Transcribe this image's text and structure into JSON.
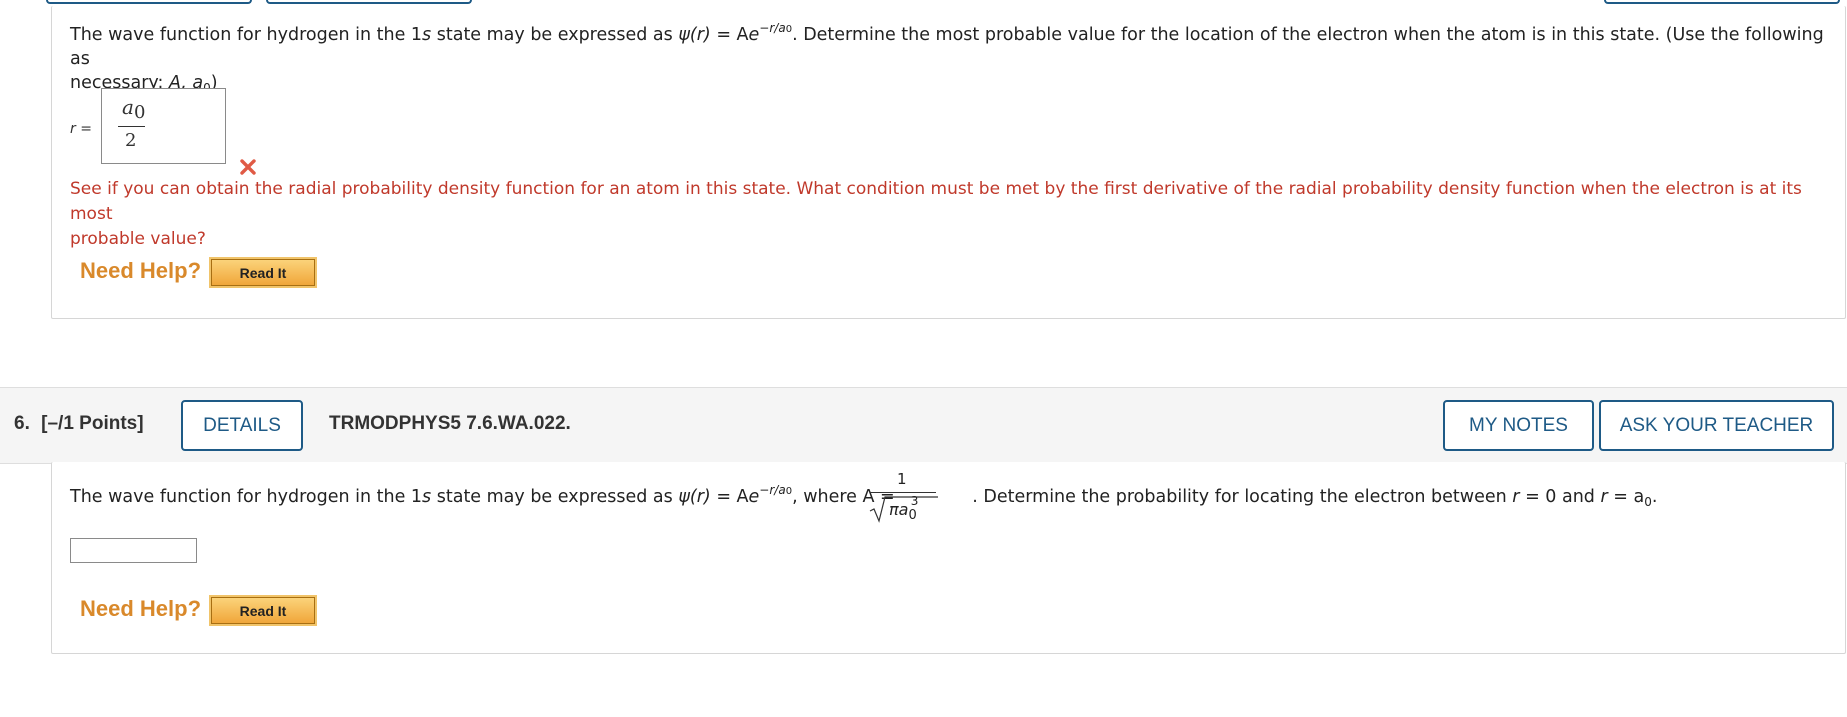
{
  "q5": {
    "text1": "The wave function for hydrogen in the 1",
    "s": "s",
    "text2": " state may be expressed as ",
    "psi": "ψ",
    "r_paren": "(r)",
    "eq": " = A",
    "e": "e",
    "exp": "−r/a",
    "exp_sub": "0",
    "text3": ". Determine the most probable value for the location of the electron when the atom is in this state. (Use the following as",
    "text4": "necessary: ",
    "vars": "A, a",
    "vars_sub": "0",
    "vars_close": ")",
    "answer_label": "r =",
    "answer_num": "a",
    "answer_num_sub": "0",
    "answer_den": "2",
    "hint_line1": "See if you can obtain the radial probability density function for an atom in this state. What condition must be met by the first derivative of the radial probability density function when the electron is at its most",
    "hint_line2": "probable value?",
    "need_help": "Need Help?",
    "read_it": "Read It",
    "status_color": "#e05a45"
  },
  "q6": {
    "number": "6.",
    "points": "[–/1 Points]",
    "details": "DETAILS",
    "code": "TRMODPHYS5 7.6.WA.022.",
    "my_notes": "MY NOTES",
    "ask_teacher": "ASK YOUR TEACHER",
    "text1": "The wave function for hydrogen in the 1",
    "s": "s",
    "text2": " state may be expressed as ",
    "psi": "ψ",
    "r_paren": "(r)",
    "eq": " = A",
    "e": "e",
    "exp": "−r/a",
    "exp_sub": "0",
    "text3": ", where A = ",
    "frac_num": "1",
    "frac_den": "πa",
    "frac_den_sub": "0",
    "frac_den_sup": "3",
    "text4": ". Determine the probability for locating the electron between ",
    "r1": "r",
    "eq0": " = 0 and ",
    "r2": "r",
    "eqa": " = a",
    "eqa_sub": "0",
    "period": ".",
    "need_help": "Need Help?",
    "read_it": "Read It"
  }
}
